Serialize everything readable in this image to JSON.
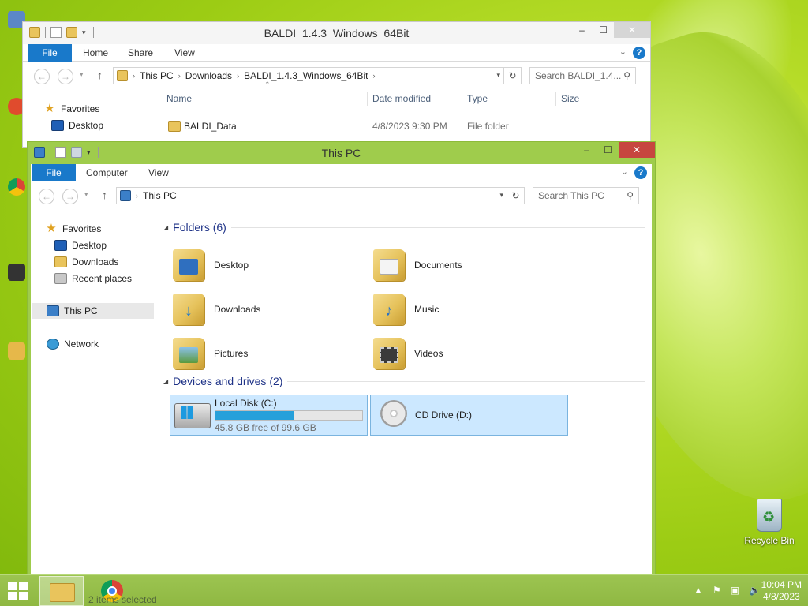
{
  "desktop": {
    "recycle_label": "Recycle Bin"
  },
  "back_window": {
    "title": "BALDI_1.4.3_Windows_64Bit",
    "tabs": {
      "file": "File",
      "home": "Home",
      "share": "Share",
      "view": "View"
    },
    "address": [
      "This PC",
      "Downloads",
      "BALDI_1.4.3_Windows_64Bit"
    ],
    "search_placeholder": "Search BALDI_1.4...",
    "columns": {
      "name": "Name",
      "date": "Date modified",
      "type": "Type",
      "size": "Size"
    },
    "nav": {
      "favorites": "Favorites",
      "desktop": "Desktop"
    },
    "files": [
      {
        "name": "BALDI_Data",
        "date": "4/8/2023 9:30 PM",
        "type": "File folder"
      }
    ]
  },
  "front_window": {
    "title": "This PC",
    "tabs": {
      "file": "File",
      "computer": "Computer",
      "view": "View"
    },
    "address": [
      "This PC"
    ],
    "search_placeholder": "Search This PC",
    "nav": {
      "favorites": "Favorites",
      "desktop": "Desktop",
      "downloads": "Downloads",
      "recent": "Recent places",
      "this_pc": "This PC",
      "network": "Network"
    },
    "folders_header": "Folders (6)",
    "folders": [
      {
        "label": "Desktop",
        "icon": "desktop-folder-icon"
      },
      {
        "label": "Documents",
        "icon": "documents-folder-icon"
      },
      {
        "label": "Downloads",
        "icon": "downloads-folder-icon"
      },
      {
        "label": "Music",
        "icon": "music-folder-icon"
      },
      {
        "label": "Pictures",
        "icon": "pictures-folder-icon"
      },
      {
        "label": "Videos",
        "icon": "videos-folder-icon"
      }
    ],
    "devices_header": "Devices and drives (2)",
    "drives": [
      {
        "label": "Local Disk (C:)",
        "free_text": "45.8 GB free of 99.6 GB",
        "used_fraction": 0.54
      },
      {
        "label": "CD Drive (D:)"
      }
    ]
  },
  "taskbar": {
    "status_ghost": "2 items   selected",
    "time": "10:04 PM",
    "date": "4/8/2023"
  },
  "colors": {
    "accent": "#1979ca",
    "front_frame": "#9fcc4c",
    "close": "#c7463f",
    "selection": "#cce8ff"
  }
}
